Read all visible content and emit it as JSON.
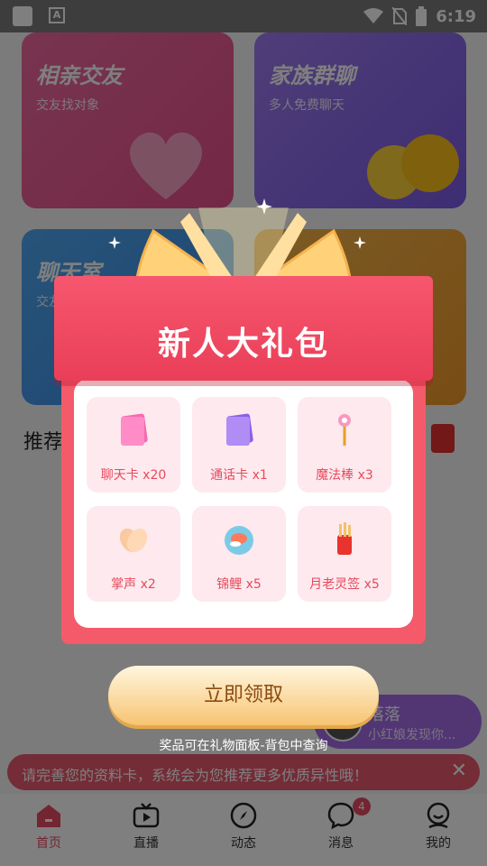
{
  "status_bar": {
    "time": "6:19"
  },
  "cards": [
    {
      "title": "相亲交友",
      "subtitle": "交友找对象"
    },
    {
      "title": "家族群聊",
      "subtitle": "多人免费聊天"
    },
    {
      "title": "聊天室",
      "subtitle": "交友"
    },
    {
      "title": "",
      "subtitle": ""
    }
  ],
  "recommend_label": "推荐",
  "floating_pill": {
    "title": "落落",
    "subtitle": "小红娘发现你..."
  },
  "notice": {
    "text": "请完善您的资料卡，系统会为您推荐更多优质异性哦！"
  },
  "modal": {
    "title": "新人大礼包",
    "prizes": [
      {
        "label": "聊天卡 x20",
        "icon": "chat-card-icon"
      },
      {
        "label": "通话卡 x1",
        "icon": "call-card-icon"
      },
      {
        "label": "魔法棒 x3",
        "icon": "magic-wand-icon"
      },
      {
        "label": "掌声 x2",
        "icon": "applause-icon"
      },
      {
        "label": "锦鲤 x5",
        "icon": "koi-icon"
      },
      {
        "label": "月老灵签 x5",
        "icon": "fortune-stick-icon"
      }
    ],
    "claim_label": "立即领取",
    "note": "奖品可在礼物面板-背包中查询"
  },
  "tabs": [
    {
      "label": "首页",
      "active": true
    },
    {
      "label": "直播"
    },
    {
      "label": "动态"
    },
    {
      "label": "消息",
      "badge": "4"
    },
    {
      "label": "我的"
    }
  ],
  "colors": {
    "accent": "#e74b63",
    "gift_red": "#f45a6a",
    "claim_gold": "#f7c472"
  }
}
